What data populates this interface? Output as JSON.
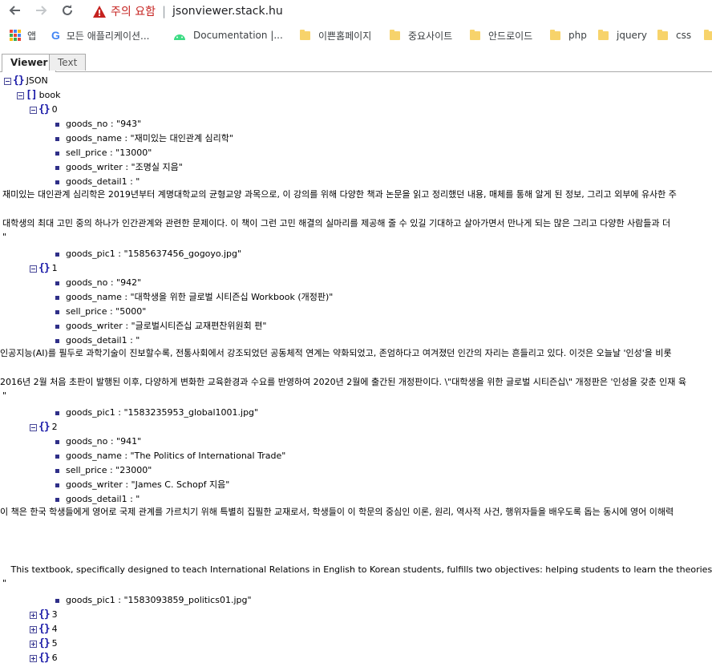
{
  "browser": {
    "security_warning": "주의 요함",
    "url": "jsonviewer.stack.hu",
    "bookmarks": [
      {
        "label": "앱",
        "icon": "apps-grid-icon"
      },
      {
        "label": "모든 애플리케이션...",
        "icon": "google-icon"
      },
      {
        "label": "Documentation  |...",
        "icon": "android-icon"
      },
      {
        "label": "이쁜홈페이지",
        "icon": "folder-icon"
      },
      {
        "label": "중요사이트",
        "icon": "folder-icon"
      },
      {
        "label": "안드로이드",
        "icon": "folder-icon"
      },
      {
        "label": "php",
        "icon": "folder-icon"
      },
      {
        "label": "jquery",
        "icon": "folder-icon"
      },
      {
        "label": "css",
        "icon": "folder-icon"
      }
    ]
  },
  "tabs": {
    "viewer": "Viewer",
    "text": "Text"
  },
  "tree": {
    "root": "JSON",
    "book": "book",
    "items": [
      {
        "index": "0",
        "goods_no": "goods_no : \"943\"",
        "goods_name": "goods_name : \"재미있는 대인관계 심리학\"",
        "sell_price": "sell_price : \"13000\"",
        "goods_writer": "goods_writer : \"조명실 지음\"",
        "goods_detail1": "goods_detail1 : \"",
        "detail_lines": [
          "재미있는 대인관계 심리학은 2019년부터 계명대학교의 균형교양 과목으로, 이 강의를 위해 다양한 책과 논문을 읽고 정리했던 내용, 매체를 통해 알게 된 정보, 그리고 외부에 유사한 주",
          "대학생의 최대 고민 중의 하나가 인간관계와 관련한 문제이다. 이 책이 그런 고민 해결의 실마리를 제공해 줄 수 있길 기대하고 살아가면서 만나게 되는 많은 그리고 다양한 사람들과 더"
        ],
        "close_quote": "\"",
        "goods_pic1": "goods_pic1 : \"1585637456_gogoyo.jpg\""
      },
      {
        "index": "1",
        "goods_no": "goods_no : \"942\"",
        "goods_name": "goods_name : \"대학생을 위한 글로벌 시티즌십 Workbook (개정판)\"",
        "sell_price": "sell_price : \"5000\"",
        "goods_writer": "goods_writer : \"글로벌시티즌십 교재편찬위원회 편\"",
        "goods_detail1": "goods_detail1 : \"",
        "detail_lines": [
          "인공지능(AI)를 필두로 과학기술이 진보할수록, 전통사회에서 강조되었던 공동체적 연계는 약화되었고, 존엄하다고 여겨졌던 인간의 자리는 흔들리고 있다. 이것은 오늘날 '인성'을 비롯",
          "2016년 2월 처음 초판이 발행된 이후, 다양하게 변화한 교육환경과 수요를 반영하여 2020년 2월에 출간된 개정판이다. \\\"대학생을 위한 글로벌 시티즌십\\\" 개정판은 '인성을 갖춘 인재 육"
        ],
        "close_quote": "\"",
        "goods_pic1": "goods_pic1 : \"1583235953_global1001.jpg\""
      },
      {
        "index": "2",
        "goods_no": "goods_no : \"941\"",
        "goods_name": "goods_name : \"The Politics of International Trade\"",
        "sell_price": "sell_price : \"23000\"",
        "goods_writer": "goods_writer : \"James C. Schopf 지음\"",
        "goods_detail1": "goods_detail1 : \"",
        "detail_lines": [
          "이 책은 한국 학생들에게 영어로 국제 관계를 가르치기 위해 특별히 집필한 교재로서, 학생들이 이 학문의 중심인 이론, 원리, 역사적 사건, 행위자들을 배우도록 돕는 동시에 영어 이해력",
          "   This textbook, specifically designed to teach International Relations in English to Korean students, fulfills two objectives: helping students to learn the theories, principles, historic eve"
        ],
        "close_quote": "\"",
        "goods_pic1": "goods_pic1 : \"1583093859_politics01.jpg\""
      }
    ],
    "collapsed": [
      "3",
      "4",
      "5",
      "6"
    ]
  }
}
